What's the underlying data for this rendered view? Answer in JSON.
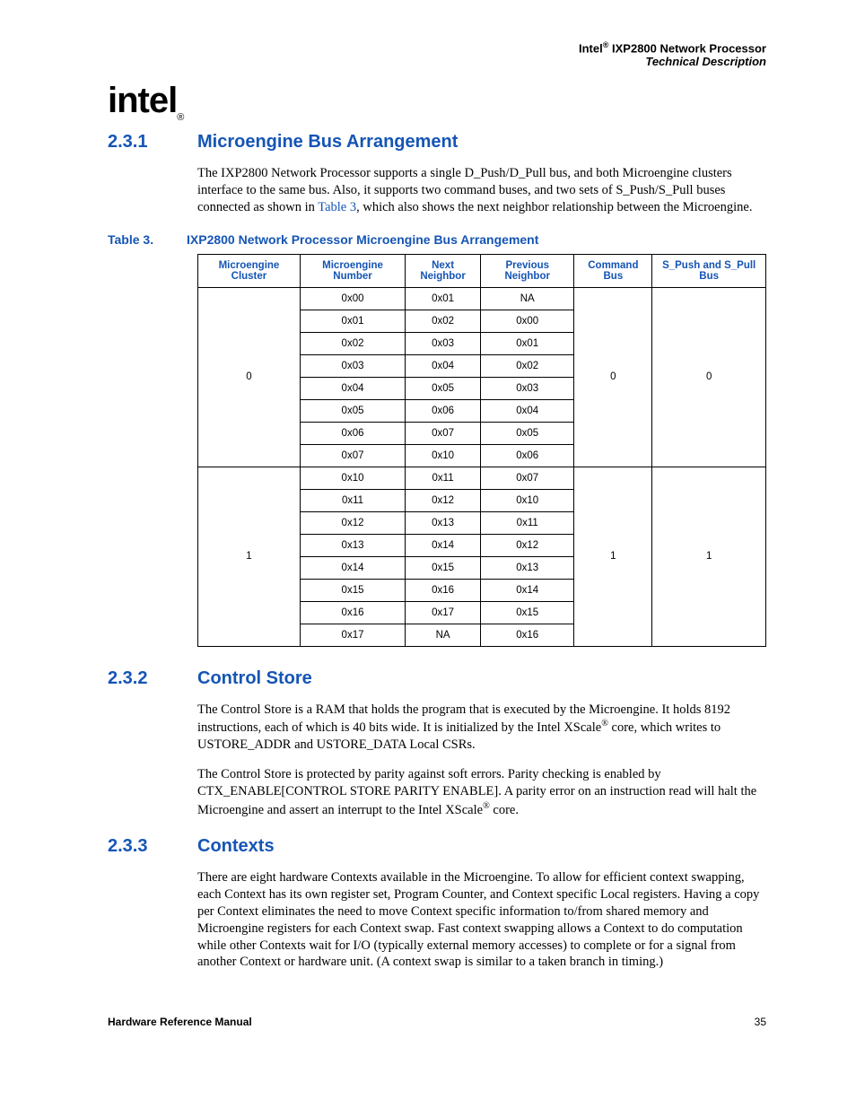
{
  "header": {
    "line1_pre": "Intel",
    "line1_sup": "®",
    "line1_post": " IXP2800 Network Processor",
    "line2": "Technical Description"
  },
  "logo": {
    "text": "intel",
    "reg": "®"
  },
  "sections": {
    "s231": {
      "num": "2.3.1",
      "title": "Microengine Bus Arrangement",
      "para1_a": "The IXP2800 Network Processor supports a single D_Push/D_Pull bus, and both Microengine clusters interface to the same bus. Also, it supports two command buses, and two sets of S_Push/S_Pull buses connected as shown in ",
      "para1_link": "Table 3",
      "para1_b": ", which also shows the next neighbor relationship between the Microengine."
    },
    "s232": {
      "num": "2.3.2",
      "title": "Control Store",
      "para1_a": "The Control Store is a RAM that holds the program that is executed by the Microengine. It holds 8192 instructions, each of which is 40 bits wide. It is initialized by the Intel XScale",
      "para1_sup": "®",
      "para1_b": " core, which writes to USTORE_ADDR and USTORE_DATA Local CSRs.",
      "para2_a": "The Control Store is protected by parity against soft errors. Parity checking is enabled by CTX_ENABLE[CONTROL STORE PARITY ENABLE]. A parity error on an instruction read will halt the Microengine and assert an interrupt to the Intel XScale",
      "para2_sup": "®",
      "para2_b": " core."
    },
    "s233": {
      "num": "2.3.3",
      "title": "Contexts",
      "para1": "There are eight hardware Contexts available in the Microengine. To allow for efficient context swapping, each Context has its own register set, Program Counter, and Context specific Local registers. Having a copy per Context eliminates the need to move Context specific information to/from shared memory and Microengine registers for each Context swap. Fast context swapping allows a Context to do computation while other Contexts wait for I/O (typically external memory accesses) to complete or for a signal from another Context or hardware unit. (A context swap is similar to a taken branch in timing.)"
    }
  },
  "table": {
    "caption_label": "Table 3.",
    "caption_title": "IXP2800 Network Processor Microengine Bus Arrangement",
    "headers": {
      "c0": "Microengine Cluster",
      "c1": "Microengine Number",
      "c2": "Next Neighbor",
      "c3": "Previous Neighbor",
      "c4": "Command Bus",
      "c5": "S_Push and S_Pull Bus"
    },
    "groups": [
      {
        "cluster": "0",
        "cmd": "0",
        "bus": "0",
        "rows": [
          {
            "num": "0x00",
            "next": "0x01",
            "prev": "NA"
          },
          {
            "num": "0x01",
            "next": "0x02",
            "prev": "0x00"
          },
          {
            "num": "0x02",
            "next": "0x03",
            "prev": "0x01"
          },
          {
            "num": "0x03",
            "next": "0x04",
            "prev": "0x02"
          },
          {
            "num": "0x04",
            "next": "0x05",
            "prev": "0x03"
          },
          {
            "num": "0x05",
            "next": "0x06",
            "prev": "0x04"
          },
          {
            "num": "0x06",
            "next": "0x07",
            "prev": "0x05"
          },
          {
            "num": "0x07",
            "next": "0x10",
            "prev": "0x06"
          }
        ]
      },
      {
        "cluster": "1",
        "cmd": "1",
        "bus": "1",
        "rows": [
          {
            "num": "0x10",
            "next": "0x11",
            "prev": "0x07"
          },
          {
            "num": "0x11",
            "next": "0x12",
            "prev": "0x10"
          },
          {
            "num": "0x12",
            "next": "0x13",
            "prev": "0x11"
          },
          {
            "num": "0x13",
            "next": "0x14",
            "prev": "0x12"
          },
          {
            "num": "0x14",
            "next": "0x15",
            "prev": "0x13"
          },
          {
            "num": "0x15",
            "next": "0x16",
            "prev": "0x14"
          },
          {
            "num": "0x16",
            "next": "0x17",
            "prev": "0x15"
          },
          {
            "num": "0x17",
            "next": "NA",
            "prev": "0x16"
          }
        ]
      }
    ]
  },
  "footer": {
    "left": "Hardware Reference Manual",
    "right": "35"
  }
}
